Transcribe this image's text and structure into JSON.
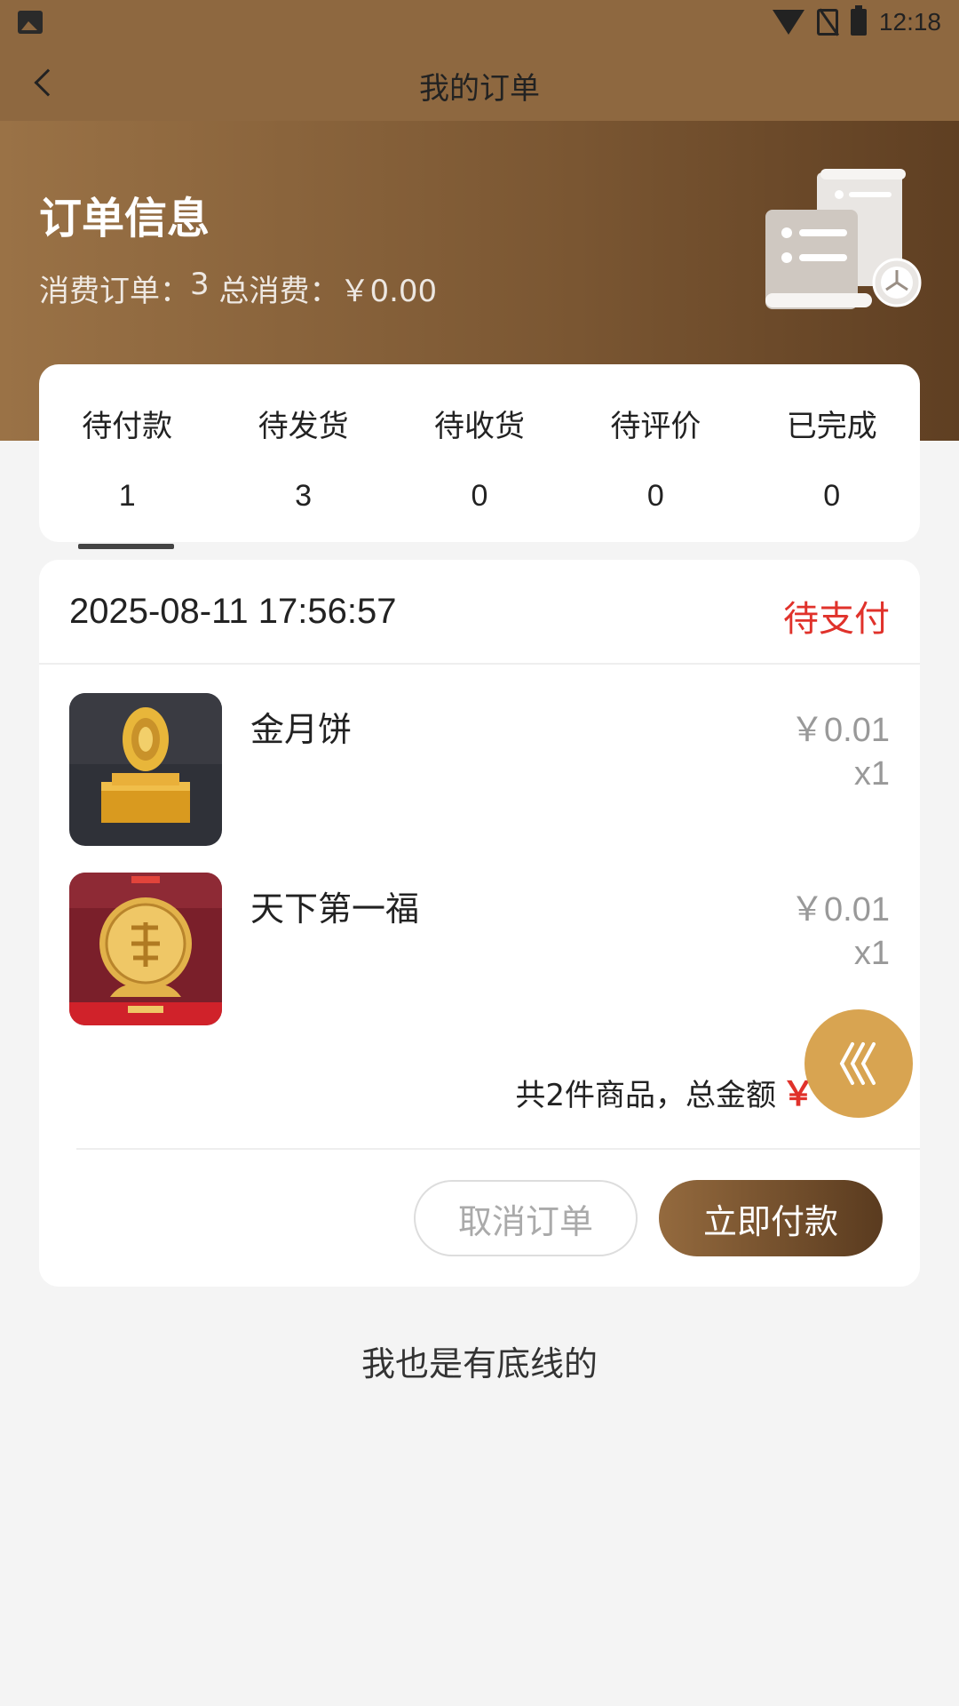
{
  "status_bar": {
    "time": "12:18",
    "icons": [
      "image-icon",
      "wifi-icon",
      "no-sim-icon",
      "battery-icon"
    ]
  },
  "nav": {
    "title": "我的订单",
    "back_icon": "chevron-left-icon"
  },
  "header": {
    "title": "订单信息",
    "orders_label": "消费订单：",
    "orders_count": "3",
    "spend_label": " 总消费：",
    "spend_value": "￥0.00",
    "illustration": "receipt-scroll-clock-icon"
  },
  "tabs": [
    {
      "label": "待付款",
      "count": "1",
      "active": true
    },
    {
      "label": "待发货",
      "count": "3"
    },
    {
      "label": "待收货",
      "count": "0"
    },
    {
      "label": "待评价",
      "count": "0"
    },
    {
      "label": "已完成",
      "count": "0"
    }
  ],
  "order": {
    "time": "2025-08-11 17:56:57",
    "status": "待支付",
    "items": [
      {
        "name": "金月饼",
        "price": "￥0.01",
        "qty": "x1"
      },
      {
        "name": "天下第一福",
        "price": "￥0.01",
        "qty": "x1"
      }
    ],
    "total_text": "共2件商品，总金额",
    "total_currency": "￥",
    "cancel_label": "取消订单",
    "pay_label": "立即付款"
  },
  "float_button_icon": "scroll-top-icon",
  "footer": "我也是有底线的",
  "colors": {
    "brand": "#8e6840",
    "status_red": "#e0322b",
    "float_gold": "#d8a451"
  }
}
